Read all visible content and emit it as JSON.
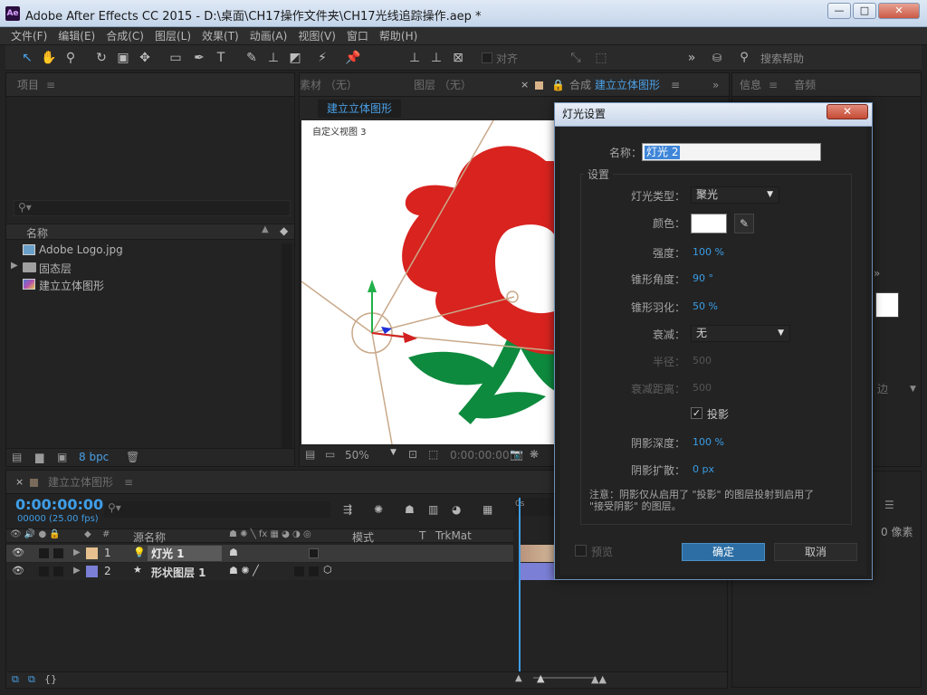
{
  "window": {
    "title": "Adobe After Effects CC 2015 - D:\\桌面\\CH17操作文件夹\\CH17光线追踪操作.aep *",
    "app_icon": "Ae",
    "minimize": "—",
    "maximize": "□",
    "close": "✕"
  },
  "menu": [
    "文件(F)",
    "编辑(E)",
    "合成(C)",
    "图层(L)",
    "效果(T)",
    "动画(A)",
    "视图(V)",
    "窗口",
    "帮助(H)"
  ],
  "toolbar": {
    "align_label": "对齐",
    "search_label": "搜索帮助",
    "more": "»"
  },
  "project_panel": {
    "tab": "项目",
    "menu_icon": "≡",
    "search_placeholder": "",
    "column_name": "名称",
    "items": [
      {
        "name": "Adobe Logo.jpg",
        "icon": "image-icon"
      },
      {
        "name": "固态层",
        "icon": "folder-icon"
      },
      {
        "name": "建立立体图形",
        "icon": "composition-icon"
      }
    ],
    "bpc": "8 bpc"
  },
  "viewer": {
    "tabs": [
      "素材 （无）",
      "图层 （无）",
      "合成 建立立体图形"
    ],
    "comp_tab_label": "合成",
    "comp_tab_name": "建立立体图形",
    "breadcrumb": "建立立体图形",
    "view_label": "自定义视图 3",
    "zoom": "50%",
    "timecode": "0:00:00:00"
  },
  "right_panel": {
    "info_tab": "信息",
    "audio_tab": "音频",
    "side_label_1": "边",
    "side_label_2": "0 像素"
  },
  "timeline": {
    "comp_tab": "建立立体图形",
    "timecode": "0:00:00:00",
    "fps": "00000 (25.00 fps)",
    "col_source_name": "源名称",
    "col_mode": "模式",
    "col_t": "T",
    "col_trkmat": "TrkMat",
    "layers": [
      {
        "num": "1",
        "name": "灯光 1",
        "color": "#e6c08f",
        "type_icon": "light-icon"
      },
      {
        "num": "2",
        "name": "形状图层 1",
        "color": "#7b7fd6",
        "type_icon": "star-icon"
      }
    ],
    "ruler_start": "0s"
  },
  "dialog": {
    "title": "灯光设置",
    "close": "✕",
    "name_label": "名称：",
    "name_value": "灯光 2",
    "settings_group": "设置",
    "fields": {
      "light_type_label": "灯光类型：",
      "light_type_value": "聚光",
      "color_label": "颜色：",
      "color_value": "#ffffff",
      "intensity_label": "强度：",
      "intensity_value": "100 %",
      "cone_angle_label": "锥形角度：",
      "cone_angle_value": "90 °",
      "cone_feather_label": "锥形羽化：",
      "cone_feather_value": "50 %",
      "falloff_label": "衰减：",
      "falloff_value": "无",
      "radius_label": "半径：",
      "radius_value": "500",
      "falloff_dist_label": "衰减距离：",
      "falloff_dist_value": "500",
      "cast_shadows_label": "投影",
      "cast_shadows_checked": true,
      "shadow_darkness_label": "阴影深度：",
      "shadow_darkness_value": "100 %",
      "shadow_diffusion_label": "阴影扩散：",
      "shadow_diffusion_value": "0 px"
    },
    "note": "注意：阴影仅从启用了 \"投影\" 的图层投射到启用了 \"接受阴影\" 的图层。",
    "preview_label": "预览",
    "ok_label": "确定",
    "cancel_label": "取消"
  }
}
